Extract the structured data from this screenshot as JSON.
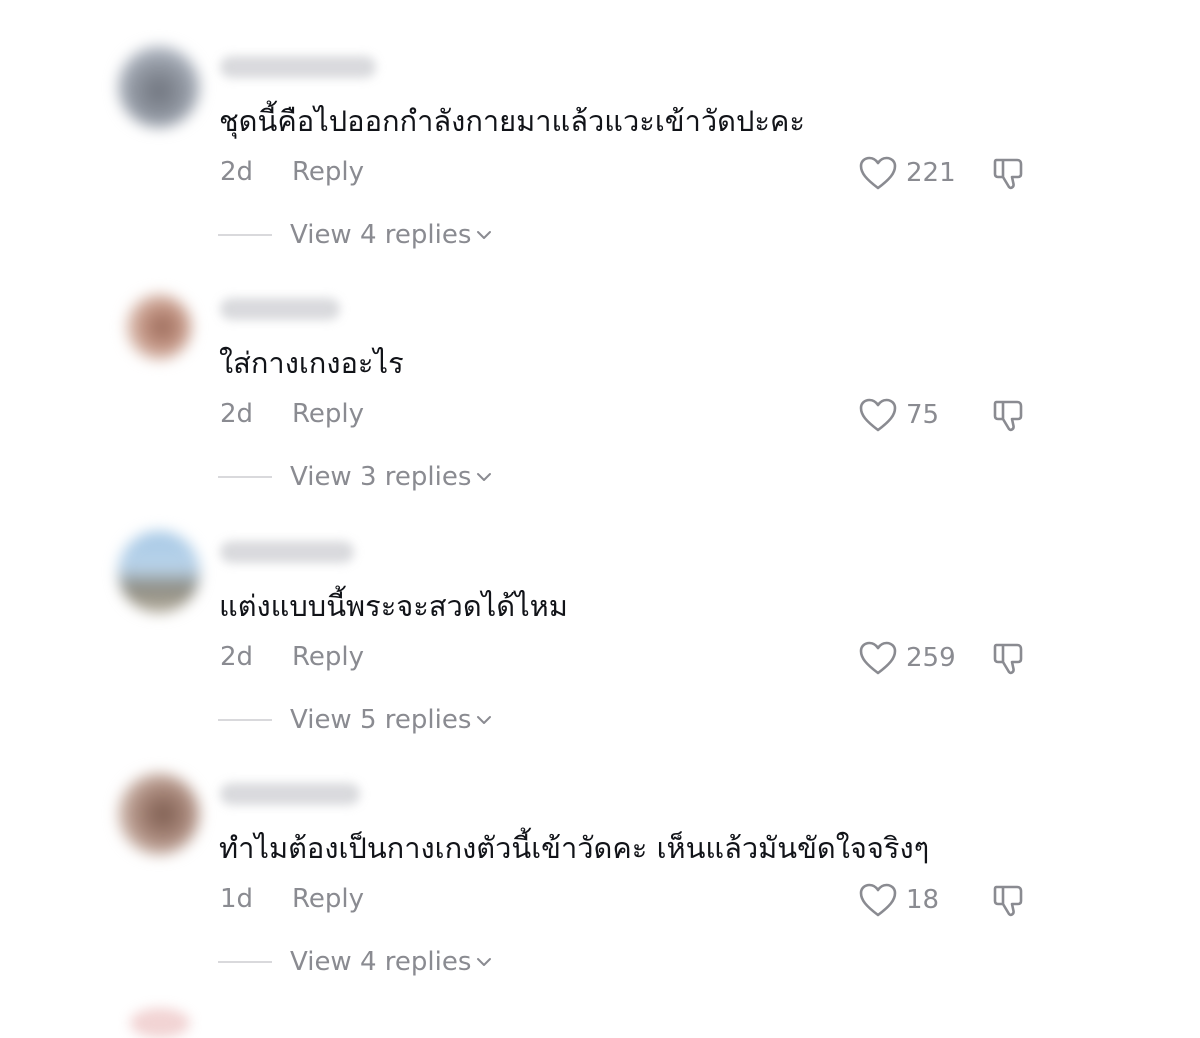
{
  "comments": [
    {
      "text": "ชุดนี้คือไปออกกำลังกายมาแล้วแวะเข้าวัดปะคะ",
      "time": "2d",
      "reply_label": "Reply",
      "likes": "221",
      "view_replies": "View 4 replies"
    },
    {
      "text": "ใส่กางเกงอะไร",
      "time": "2d",
      "reply_label": "Reply",
      "likes": "75",
      "view_replies": "View 3 replies"
    },
    {
      "text": "แต่งแบบนี้พระจะสวดได้ไหม",
      "time": "2d",
      "reply_label": "Reply",
      "likes": "259",
      "view_replies": "View 5 replies"
    },
    {
      "text": "ทำไมต้องเป็นกางเกงตัวนี้เข้าวัดคะ เห็นแล้วมันขัดใจจริงๆ",
      "time": "1d",
      "reply_label": "Reply",
      "likes": "18",
      "view_replies": "View 4 replies"
    }
  ],
  "icons": {
    "like": "heart-outline-icon",
    "dislike": "thumbs-down-icon",
    "expand": "chevron-down-icon"
  },
  "colors": {
    "text": "#161823",
    "secondary": "#8a8b91",
    "divider": "#d9d9dc"
  }
}
